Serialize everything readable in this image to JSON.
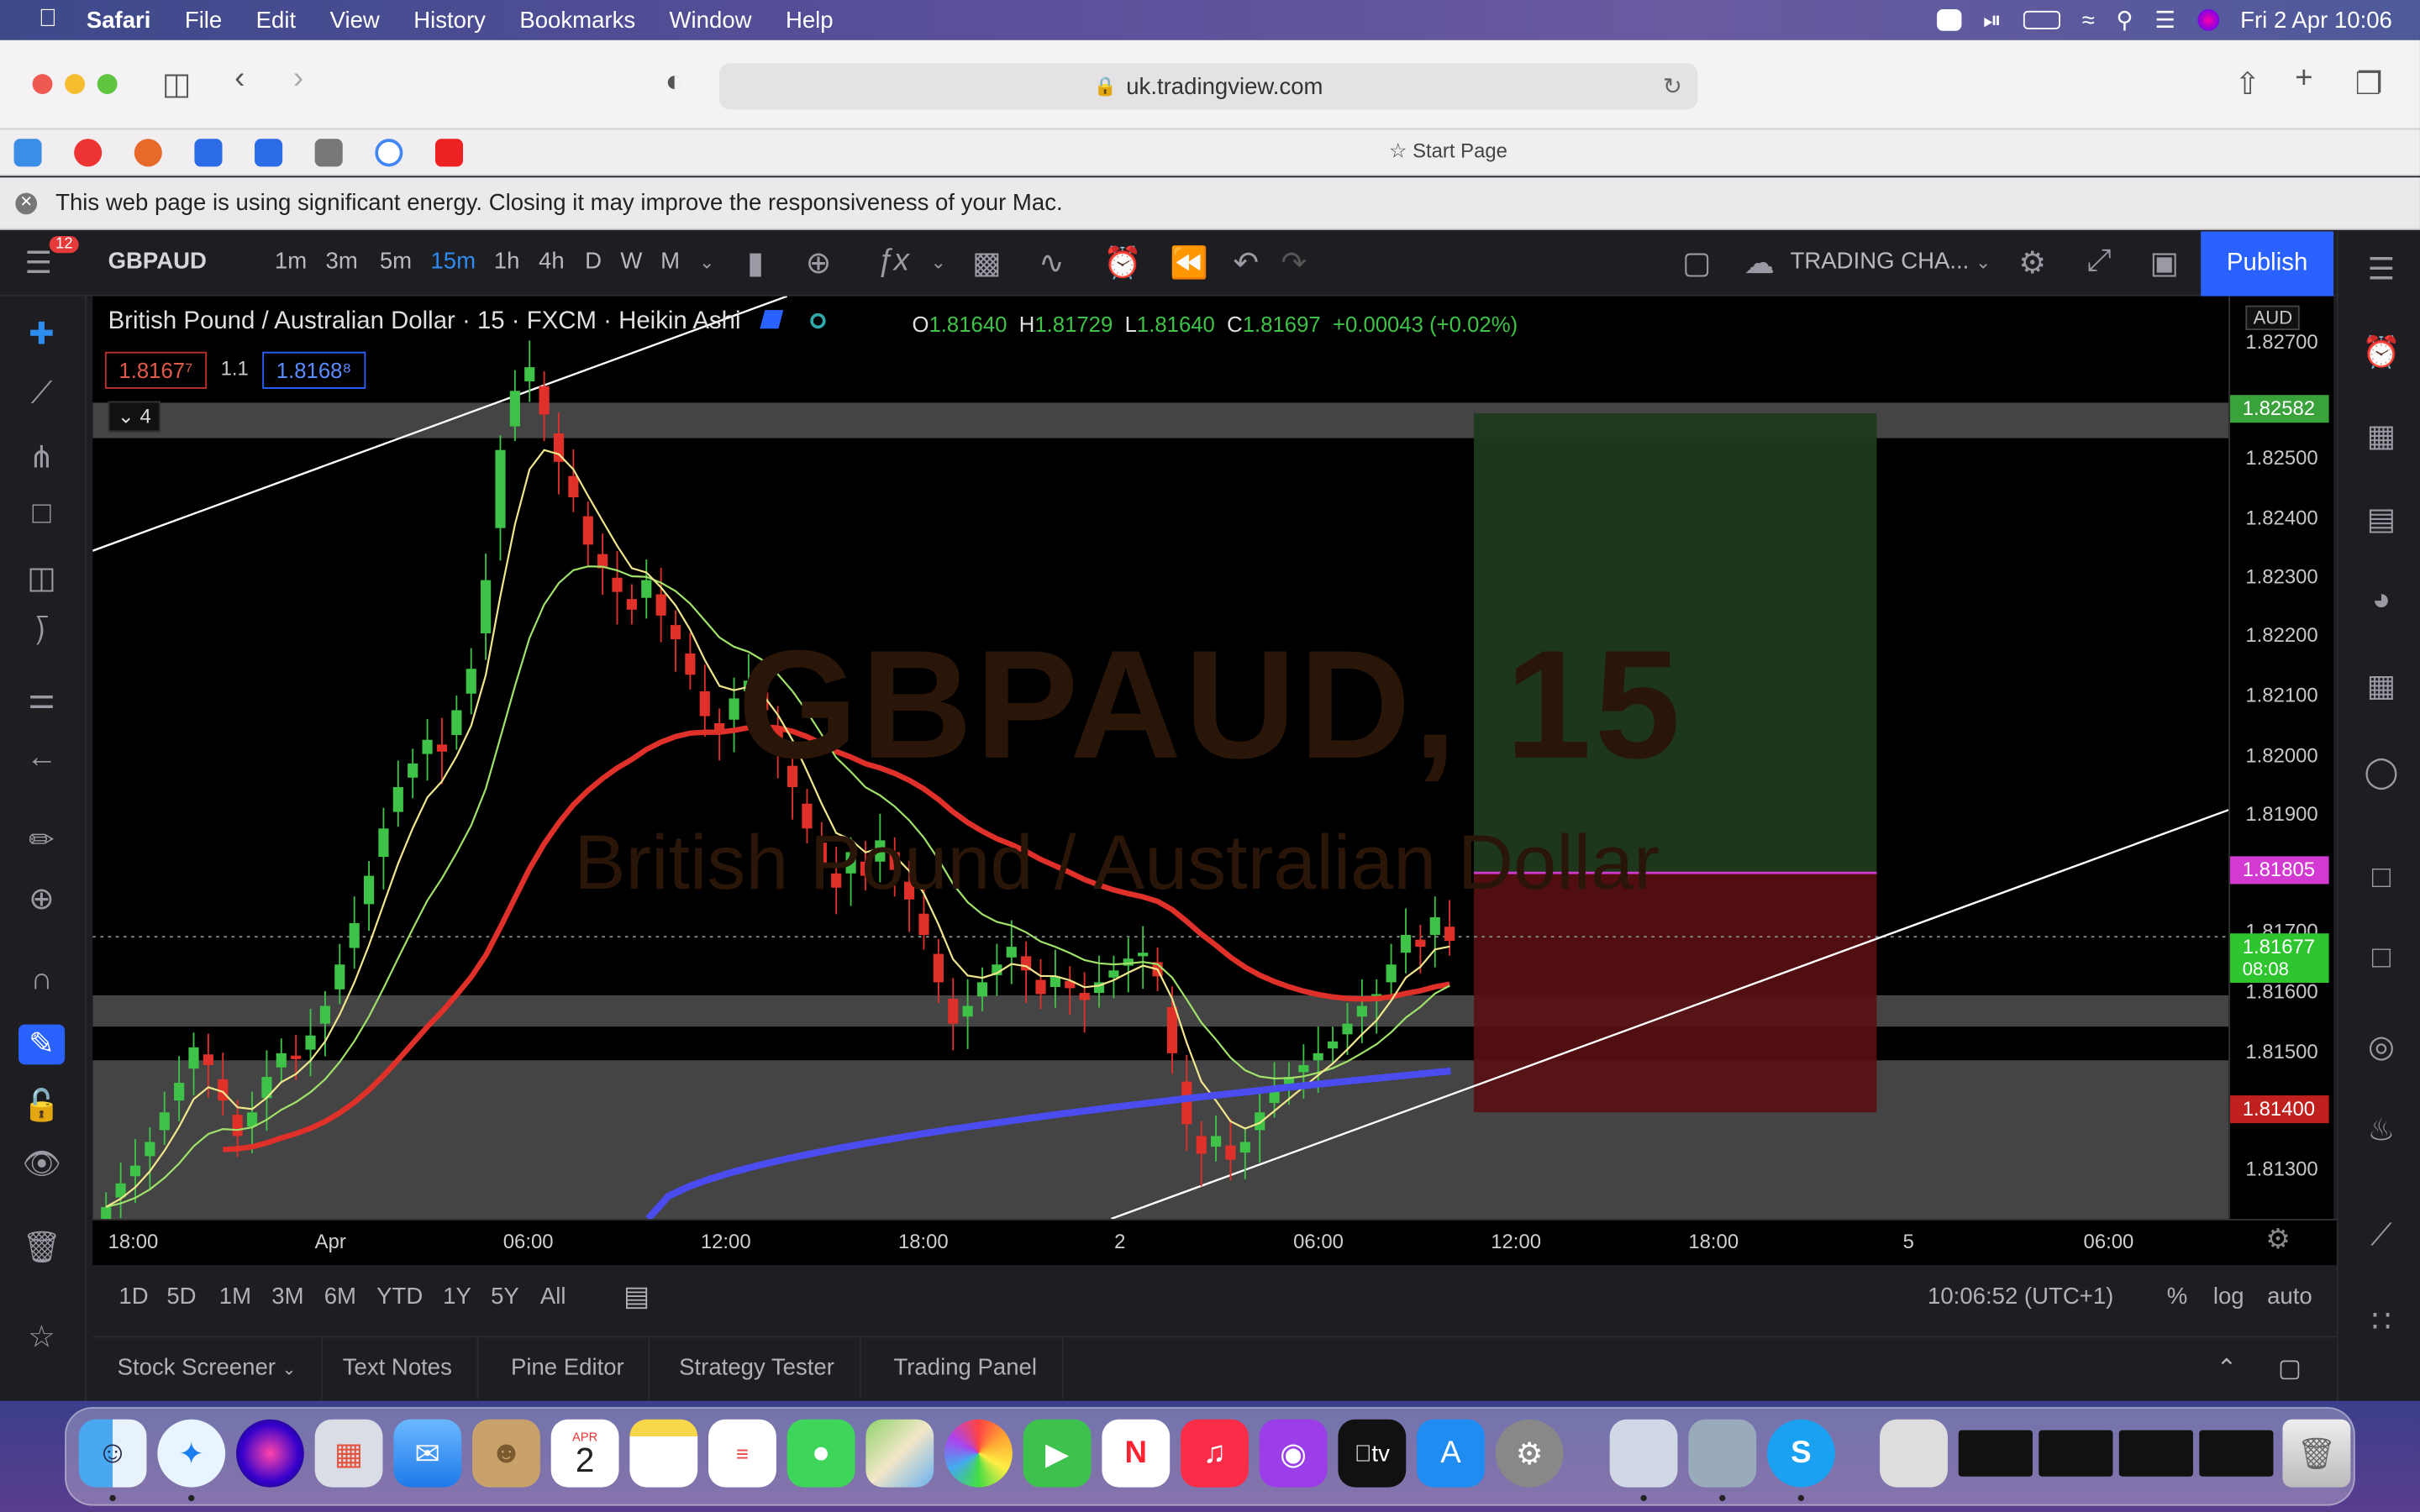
{
  "menubar": {
    "app": "Safari",
    "items": [
      "File",
      "Edit",
      "View",
      "History",
      "Bookmarks",
      "Window",
      "Help"
    ],
    "clock": "Fri 2 Apr  10:06"
  },
  "browser": {
    "url": "uk.tradingview.com",
    "start_page": "Start Page",
    "energy_notice": "This web page is using significant energy. Closing it may improve the responsiveness of your Mac."
  },
  "toolbar": {
    "symbol": "GBPAUD",
    "notifications": "12",
    "timeframes": [
      "1m",
      "3m",
      "5m",
      "15m",
      "1h",
      "4h",
      "D",
      "W",
      "M"
    ],
    "active_timeframe": "15m",
    "layout_name": "TRADING CHA...",
    "publish": "Publish"
  },
  "legend": {
    "title": "British Pound / Australian Dollar · 15 · FXCM · Heikin Ashi",
    "o_label": "O",
    "o": "1.81640",
    "h_label": "H",
    "h": "1.81729",
    "l_label": "L",
    "l": "1.81640",
    "c_label": "C",
    "c": "1.81697",
    "change": "+0.00043 (+0.02%)",
    "sell_price": "1.8167⁷",
    "spread": "1.1",
    "buy_price": "1.8168⁸",
    "indicators_count": "4"
  },
  "watermark": {
    "symbol": "GBPAUD, 15",
    "name": "British Pound / Australian Dollar"
  },
  "price_axis": {
    "currency": "AUD",
    "ticks": [
      "1.82700",
      "1.82500",
      "1.82400",
      "1.82300",
      "1.82200",
      "1.82100",
      "1.82000",
      "1.81900",
      "1.81700",
      "1.81600",
      "1.81500",
      "1.81300"
    ],
    "target_label": "1.82582",
    "entry_label": "1.81805",
    "current_label": "1.81677",
    "countdown": "08:08",
    "stop_label": "1.81400"
  },
  "time_axis": {
    "ticks": [
      "18:00",
      "Apr",
      "06:00",
      "12:00",
      "18:00",
      "2",
      "06:00",
      "12:00",
      "18:00",
      "5",
      "06:00"
    ]
  },
  "bottom_bar": {
    "ranges": [
      "1D",
      "5D",
      "1M",
      "3M",
      "6M",
      "YTD",
      "1Y",
      "5Y",
      "All"
    ],
    "clock": "10:06:52 (UTC+1)",
    "percent": "%",
    "log": "log",
    "auto": "auto"
  },
  "panels": [
    "Stock Screener",
    "Text Notes",
    "Pine Editor",
    "Strategy Tester",
    "Trading Panel"
  ],
  "dock": {
    "calendar_month": "APR",
    "calendar_day": "2",
    "tv_label": "tv"
  },
  "colors": {
    "up": "#3ec247",
    "down": "#e0302a",
    "ema_red": "#e0302a",
    "ma_blue": "#4a4cf0",
    "accent": "#2962ff",
    "target_zone": "#1f3a1f",
    "stop_zone": "#5a0f12"
  },
  "chart_data": {
    "type": "candlestick",
    "symbol": "GBPAUD",
    "interval": "15",
    "ylim": [
      1.8122,
      1.8278
    ],
    "candles_close": [
      1.8124,
      1.8128,
      1.8131,
      1.8135,
      1.814,
      1.8145,
      1.8151,
      1.8148,
      1.8142,
      1.8136,
      1.814,
      1.8146,
      1.815,
      1.8149,
      1.8153,
      1.8158,
      1.8165,
      1.8172,
      1.818,
      1.8188,
      1.8195,
      1.8199,
      1.8203,
      1.8201,
      1.8208,
      1.8215,
      1.823,
      1.8252,
      1.8262,
      1.8266,
      1.8258,
      1.825,
      1.8244,
      1.8236,
      1.8232,
      1.8228,
      1.8225,
      1.823,
      1.8224,
      1.822,
      1.8214,
      1.8207,
      1.8204,
      1.821,
      1.8213,
      1.8208,
      1.8201,
      1.8195,
      1.8188,
      1.8182,
      1.8178,
      1.8184,
      1.818,
      1.8186,
      1.8181,
      1.8176,
      1.817,
      1.8162,
      1.8155,
      1.8158,
      1.8162,
      1.8165,
      1.8168,
      1.8164,
      1.816,
      1.8163,
      1.8161,
      1.8159,
      1.8162,
      1.8164,
      1.8166,
      1.8167,
      1.8163,
      1.815,
      1.8138,
      1.8133,
      1.8136,
      1.8132,
      1.8135,
      1.814,
      1.8144,
      1.8146,
      1.8148,
      1.815,
      1.8152,
      1.8155,
      1.8158,
      1.816,
      1.8165,
      1.817,
      1.8168,
      1.8173,
      1.8169
    ]
  }
}
